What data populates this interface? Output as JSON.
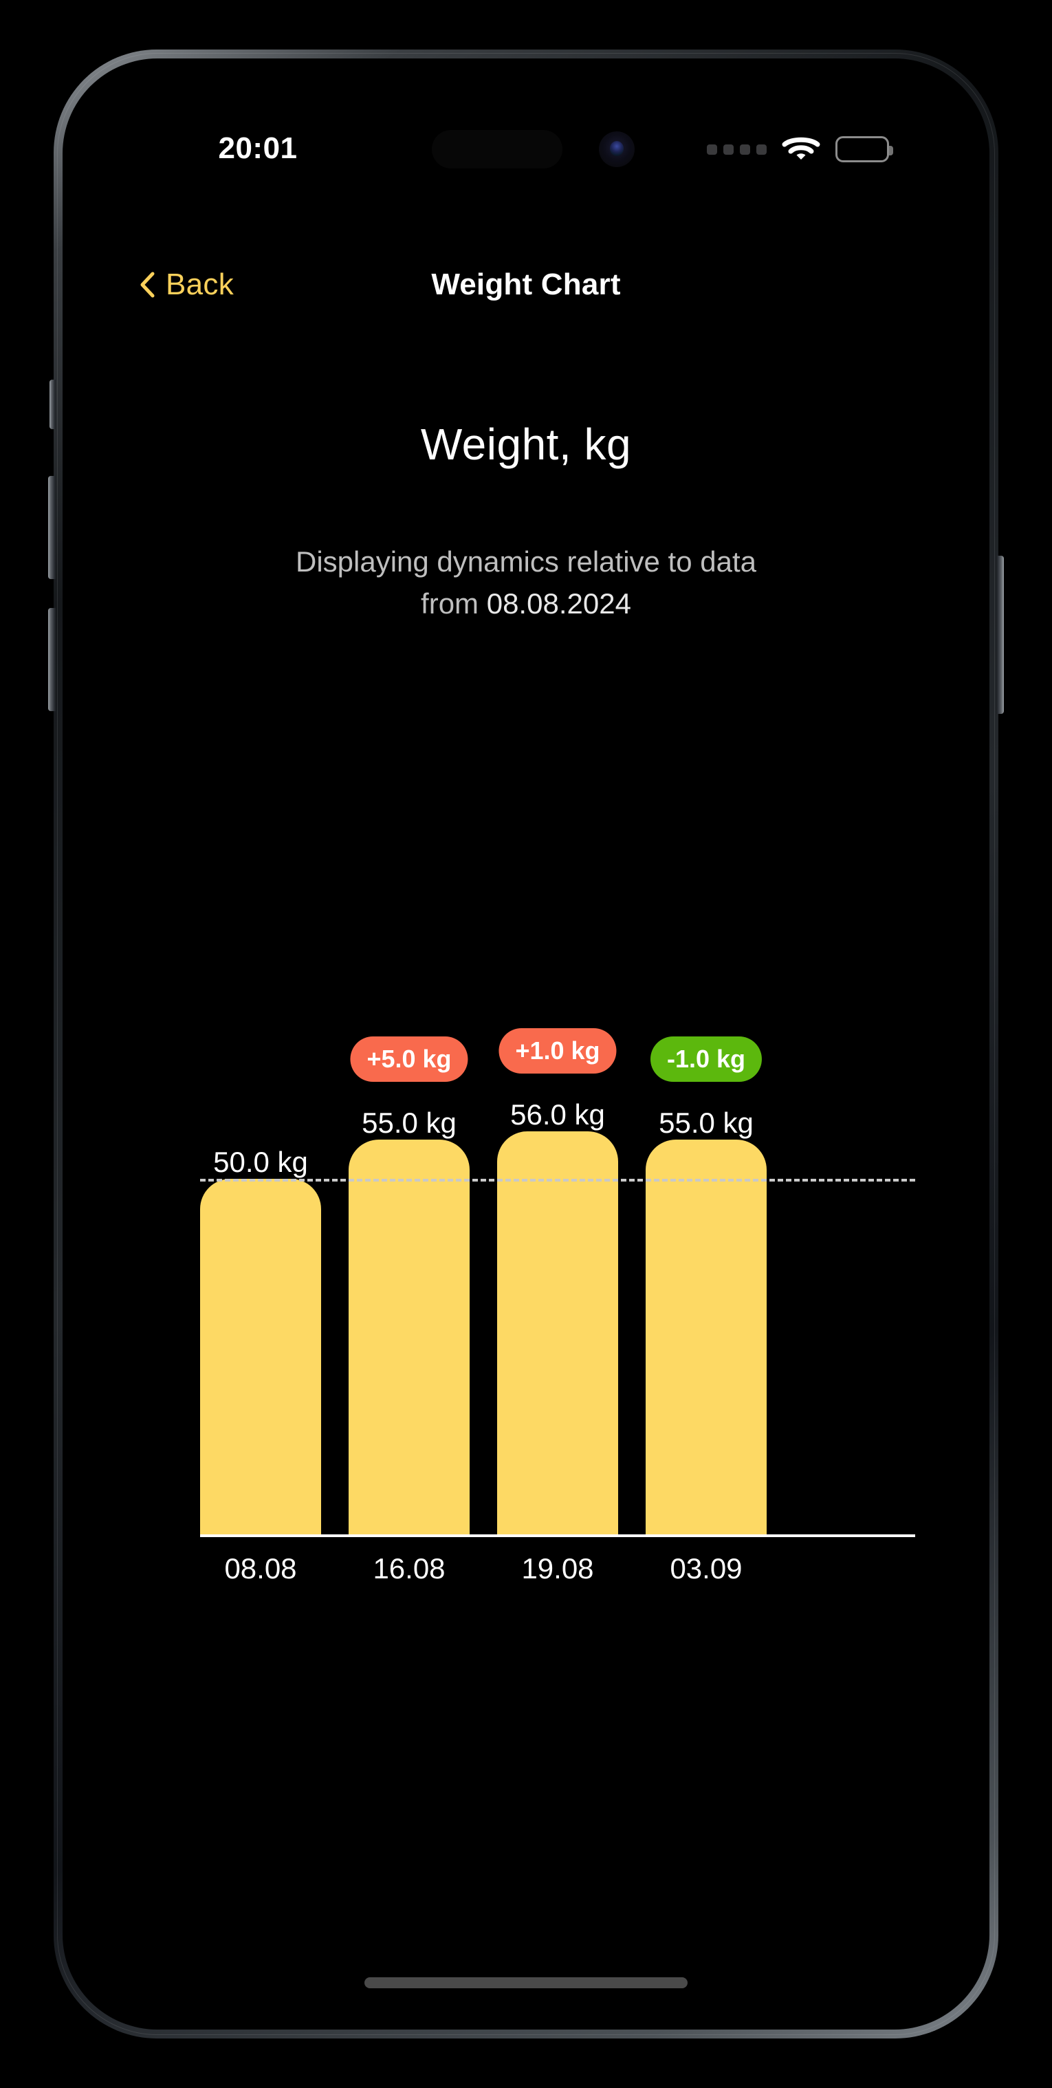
{
  "status_bar": {
    "time": "20:01",
    "cellular_icon": "signal-dots-icon",
    "wifi_icon": "wifi-icon",
    "battery_icon": "battery-full-icon",
    "battery_level_percent": 100
  },
  "navbar": {
    "back_label": "Back",
    "back_icon": "chevron-left-icon",
    "title": "Weight Chart",
    "accent_color": "#FBD15B"
  },
  "header": {
    "title": "Weight, kg",
    "subtitle_line1": "Displaying dynamics relative to data",
    "subtitle_prefix": "from ",
    "subtitle_date": "08.08.2024"
  },
  "chart_data": {
    "type": "bar",
    "title": "Weight, kg",
    "xlabel": "",
    "ylabel": "Weight, kg",
    "unit": "kg",
    "baseline_value": 50.0,
    "baseline_label": "50.0 kg",
    "grid": false,
    "legend": false,
    "ylim": [
      0,
      58
    ],
    "categories": [
      "08.08",
      "16.08",
      "19.08",
      "03.09"
    ],
    "values": [
      50.0,
      55.0,
      56.0,
      55.0
    ],
    "value_labels": [
      "50.0 kg",
      "55.0 kg",
      "56.0 kg",
      "55.0 kg"
    ],
    "deltas": [
      null,
      "+5.0 kg",
      "+1.0 kg",
      "-1.0 kg"
    ],
    "delta_values": [
      null,
      5.0,
      1.0,
      -1.0
    ],
    "delta_colors": [
      null,
      "#F96A4D",
      "#F96A4D",
      "#5CB80D"
    ],
    "bar_color": "#FDD964",
    "axis_color": "#FFFFFF",
    "baseline_line_style": "dashed",
    "baseline_line_color": "#C9C9C9"
  },
  "bars": [
    {
      "x_label": "08.08",
      "value_label": "50.0 kg",
      "delta": "",
      "delta_color": ""
    },
    {
      "x_label": "16.08",
      "value_label": "55.0 kg",
      "delta": "+5.0 kg",
      "delta_color": "#F96A4D"
    },
    {
      "x_label": "19.08",
      "value_label": "56.0 kg",
      "delta": "+1.0 kg",
      "delta_color": "#F96A4D"
    },
    {
      "x_label": "03.09",
      "value_label": "55.0 kg",
      "delta": "-1.0 kg",
      "delta_color": "#5CB80D"
    }
  ],
  "system": {
    "home_indicator": "home-indicator"
  }
}
